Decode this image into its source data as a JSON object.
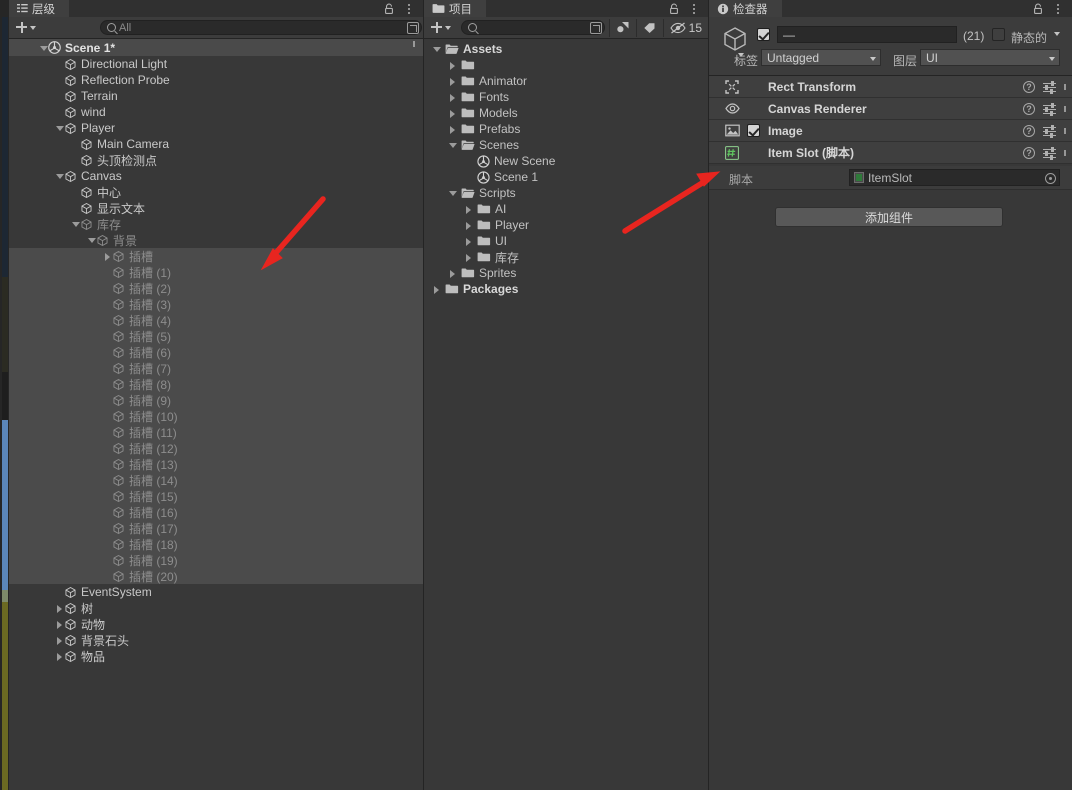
{
  "app": {
    "accent": "#4b4b4b",
    "annotation_color": "#e8251f"
  },
  "hierarchy": {
    "tab_label": "层级",
    "search_placeholder": "All",
    "scene_label": "Scene 1*",
    "items": [
      {
        "label": "Directional Light",
        "indent": 2,
        "twisty": "none",
        "dim": false
      },
      {
        "label": "Reflection Probe",
        "indent": 2,
        "twisty": "none",
        "dim": false
      },
      {
        "label": "Terrain",
        "indent": 2,
        "twisty": "none",
        "dim": false
      },
      {
        "label": "wind",
        "indent": 2,
        "twisty": "none",
        "dim": false
      },
      {
        "label": "Player",
        "indent": 2,
        "twisty": "open",
        "dim": false
      },
      {
        "label": "Main Camera",
        "indent": 3,
        "twisty": "none",
        "dim": false
      },
      {
        "label": "头顶检测点",
        "indent": 3,
        "twisty": "none",
        "dim": false
      },
      {
        "label": "Canvas",
        "indent": 2,
        "twisty": "open",
        "dim": false
      },
      {
        "label": "中心",
        "indent": 3,
        "twisty": "none",
        "dim": false
      },
      {
        "label": "显示文本",
        "indent": 3,
        "twisty": "none",
        "dim": false
      },
      {
        "label": "库存",
        "indent": 3,
        "twisty": "open",
        "dim": true
      },
      {
        "label": "背景",
        "indent": 4,
        "twisty": "open",
        "dim": true
      },
      {
        "label": "插槽",
        "indent": 5,
        "twisty": "closed",
        "dim": true,
        "selected": true
      },
      {
        "label": "插槽 (1)",
        "indent": 5,
        "twisty": "none",
        "dim": true,
        "selected": true
      },
      {
        "label": "插槽 (2)",
        "indent": 5,
        "twisty": "none",
        "dim": true,
        "selected": true
      },
      {
        "label": "插槽 (3)",
        "indent": 5,
        "twisty": "none",
        "dim": true,
        "selected": true
      },
      {
        "label": "插槽 (4)",
        "indent": 5,
        "twisty": "none",
        "dim": true,
        "selected": true
      },
      {
        "label": "插槽 (5)",
        "indent": 5,
        "twisty": "none",
        "dim": true,
        "selected": true
      },
      {
        "label": "插槽 (6)",
        "indent": 5,
        "twisty": "none",
        "dim": true,
        "selected": true
      },
      {
        "label": "插槽 (7)",
        "indent": 5,
        "twisty": "none",
        "dim": true,
        "selected": true
      },
      {
        "label": "插槽 (8)",
        "indent": 5,
        "twisty": "none",
        "dim": true,
        "selected": true
      },
      {
        "label": "插槽 (9)",
        "indent": 5,
        "twisty": "none",
        "dim": true,
        "selected": true
      },
      {
        "label": "插槽 (10)",
        "indent": 5,
        "twisty": "none",
        "dim": true,
        "selected": true
      },
      {
        "label": "插槽 (11)",
        "indent": 5,
        "twisty": "none",
        "dim": true,
        "selected": true
      },
      {
        "label": "插槽 (12)",
        "indent": 5,
        "twisty": "none",
        "dim": true,
        "selected": true
      },
      {
        "label": "插槽 (13)",
        "indent": 5,
        "twisty": "none",
        "dim": true,
        "selected": true
      },
      {
        "label": "插槽 (14)",
        "indent": 5,
        "twisty": "none",
        "dim": true,
        "selected": true
      },
      {
        "label": "插槽 (15)",
        "indent": 5,
        "twisty": "none",
        "dim": true,
        "selected": true
      },
      {
        "label": "插槽 (16)",
        "indent": 5,
        "twisty": "none",
        "dim": true,
        "selected": true
      },
      {
        "label": "插槽 (17)",
        "indent": 5,
        "twisty": "none",
        "dim": true,
        "selected": true
      },
      {
        "label": "插槽 (18)",
        "indent": 5,
        "twisty": "none",
        "dim": true,
        "selected": true
      },
      {
        "label": "插槽 (19)",
        "indent": 5,
        "twisty": "none",
        "dim": true,
        "selected": true
      },
      {
        "label": "插槽 (20)",
        "indent": 5,
        "twisty": "none",
        "dim": true,
        "selected": true
      },
      {
        "label": "EventSystem",
        "indent": 2,
        "twisty": "none",
        "dim": false
      },
      {
        "label": "树",
        "indent": 2,
        "twisty": "closed",
        "dim": false
      },
      {
        "label": "动物",
        "indent": 2,
        "twisty": "closed",
        "dim": false
      },
      {
        "label": "背景石头",
        "indent": 2,
        "twisty": "closed",
        "dim": false
      },
      {
        "label": "物品",
        "indent": 2,
        "twisty": "closed",
        "dim": false
      }
    ]
  },
  "project": {
    "tab_label": "项目",
    "search_placeholder": "",
    "hidden_count": "15",
    "items": [
      {
        "label": "Assets",
        "indent": 0,
        "twisty": "open",
        "kind": "folder-open",
        "bold": true
      },
      {
        "label": "",
        "indent": 1,
        "twisty": "closed",
        "kind": "folder"
      },
      {
        "label": "Animator",
        "indent": 1,
        "twisty": "closed",
        "kind": "folder"
      },
      {
        "label": "Fonts",
        "indent": 1,
        "twisty": "closed",
        "kind": "folder"
      },
      {
        "label": "Models",
        "indent": 1,
        "twisty": "closed",
        "kind": "folder"
      },
      {
        "label": "Prefabs",
        "indent": 1,
        "twisty": "closed",
        "kind": "folder"
      },
      {
        "label": "Scenes",
        "indent": 1,
        "twisty": "open",
        "kind": "folder-open"
      },
      {
        "label": "New Scene",
        "indent": 2,
        "twisty": "none",
        "kind": "scene"
      },
      {
        "label": "Scene 1",
        "indent": 2,
        "twisty": "none",
        "kind": "scene"
      },
      {
        "label": "Scripts",
        "indent": 1,
        "twisty": "open",
        "kind": "folder-open"
      },
      {
        "label": "AI",
        "indent": 2,
        "twisty": "closed",
        "kind": "folder"
      },
      {
        "label": "Player",
        "indent": 2,
        "twisty": "closed",
        "kind": "folder"
      },
      {
        "label": "UI",
        "indent": 2,
        "twisty": "closed",
        "kind": "folder"
      },
      {
        "label": "库存",
        "indent": 2,
        "twisty": "closed",
        "kind": "folder"
      },
      {
        "label": "Sprites",
        "indent": 1,
        "twisty": "closed",
        "kind": "folder"
      },
      {
        "label": "Packages",
        "indent": 0,
        "twisty": "closed",
        "kind": "folder",
        "bold": true
      }
    ]
  },
  "inspector": {
    "tab_label": "检查器",
    "name_value": "—",
    "multi_count": "(21)",
    "static_label": "静态的",
    "tag_label": "标签",
    "tag_value": "Untagged",
    "layer_label": "图层",
    "layer_value": "UI",
    "components": [
      {
        "name": "Rect Transform",
        "icon": "rect-transform-icon",
        "expanded": false,
        "has_enable_checkbox": false
      },
      {
        "name": "Canvas Renderer",
        "icon": "canvas-renderer-icon",
        "expanded": false,
        "has_enable_checkbox": false
      },
      {
        "name": "Image",
        "icon": "image-icon",
        "expanded": false,
        "has_enable_checkbox": true,
        "enabled": true
      },
      {
        "name": "Item Slot  (脚本)",
        "icon": "script-icon",
        "expanded": true,
        "has_enable_checkbox": false
      }
    ],
    "script_field_label": "脚本",
    "script_field_value": "ItemSlot",
    "add_component_label": "添加组件"
  }
}
